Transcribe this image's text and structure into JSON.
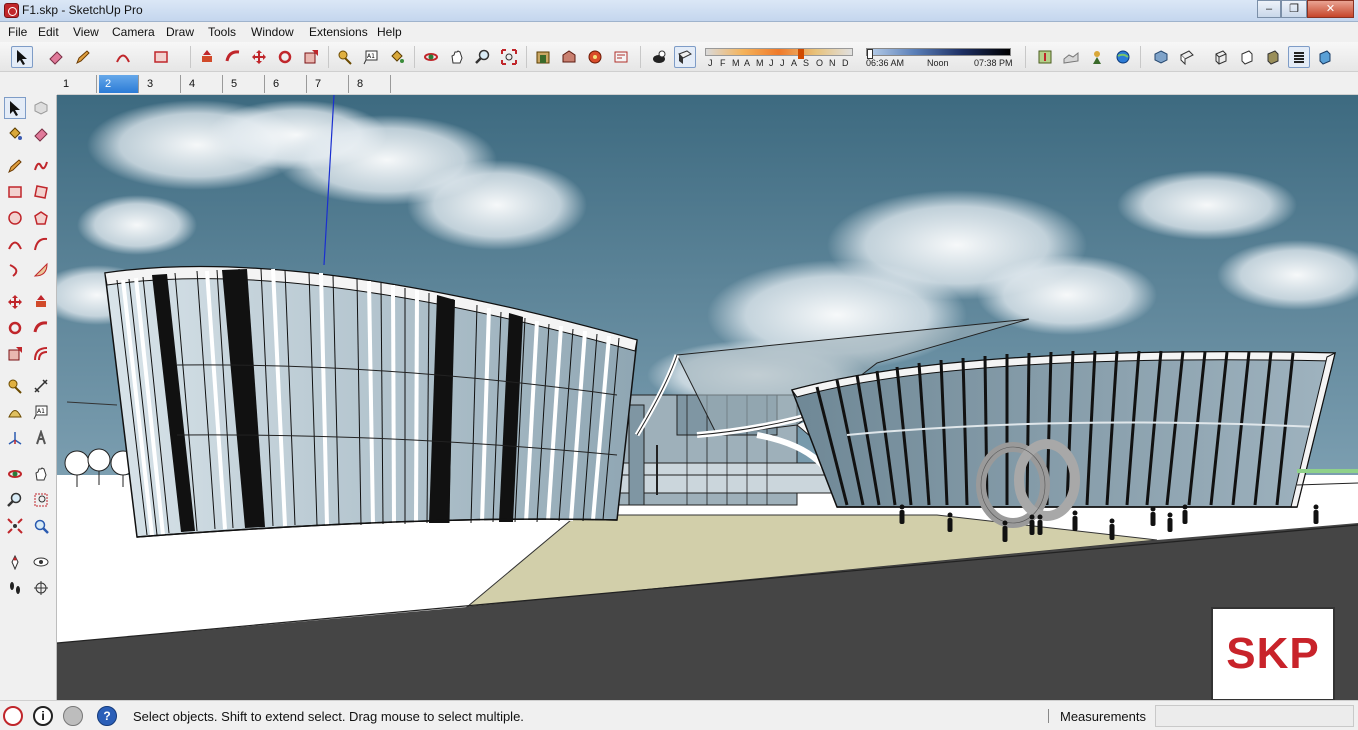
{
  "window": {
    "title": "F1.skp - SketchUp Pro"
  },
  "menu": [
    "File",
    "Edit",
    "View",
    "Camera",
    "Draw",
    "Tools",
    "Window",
    "Extensions",
    "Help"
  ],
  "shadow_settings": {
    "months": [
      "J",
      "F",
      "M",
      "A",
      "M",
      "J",
      "J",
      "A",
      "S",
      "O",
      "N",
      "D"
    ],
    "sunrise": "06:36 AM",
    "noon": "Noon",
    "sunset": "07:38 PM",
    "month_bar_color": "#f07a2a",
    "time_bar_color": "#1d2f63"
  },
  "scenes": {
    "tabs": [
      "1",
      "2",
      "3",
      "4",
      "5",
      "6",
      "7",
      "8"
    ],
    "active": "2"
  },
  "toolbar_icons": [
    "select-icon",
    "eraser-icon",
    "pencil-icon",
    "arc-icon",
    "rectangle-icon",
    "push-pull-icon",
    "follow-me-icon",
    "move-icon",
    "rotate-icon",
    "scale-icon",
    "tape-measure-icon",
    "text-icon",
    "paint-bucket-icon",
    "orbit-icon",
    "pan-icon",
    "zoom-icon",
    "zoom-extents-icon",
    "warehouse-icon",
    "share-model-icon",
    "extension-warehouse-icon",
    "layout-icon",
    "shadows-toggle-icon",
    "fog-icon",
    "iso-view-icon",
    "top-view-icon",
    "front-view-icon",
    "right-view-icon",
    "back-view-icon",
    "left-view-icon",
    "geo-location-icon",
    "sandbox-icon",
    "style-xray-icon",
    "style-wireframe-icon",
    "style-hidden-line-icon",
    "style-shaded-icon",
    "style-textured-icon",
    "style-monochrome-icon"
  ],
  "watermark": {
    "text": "SKP",
    "color": "#c8232a"
  },
  "status": {
    "hint": "Select objects. Shift to extend select. Drag mouse to select multiple.",
    "measurements_label": "Measurements",
    "measurements_value": ""
  },
  "colors": {
    "sky_top": "#3d6a80",
    "sky_bottom": "#7fa1b3",
    "ground": "#ffffff",
    "road": "#454545",
    "plaza": "#d2cfaa",
    "selection_blue": "#2b7bd6"
  }
}
